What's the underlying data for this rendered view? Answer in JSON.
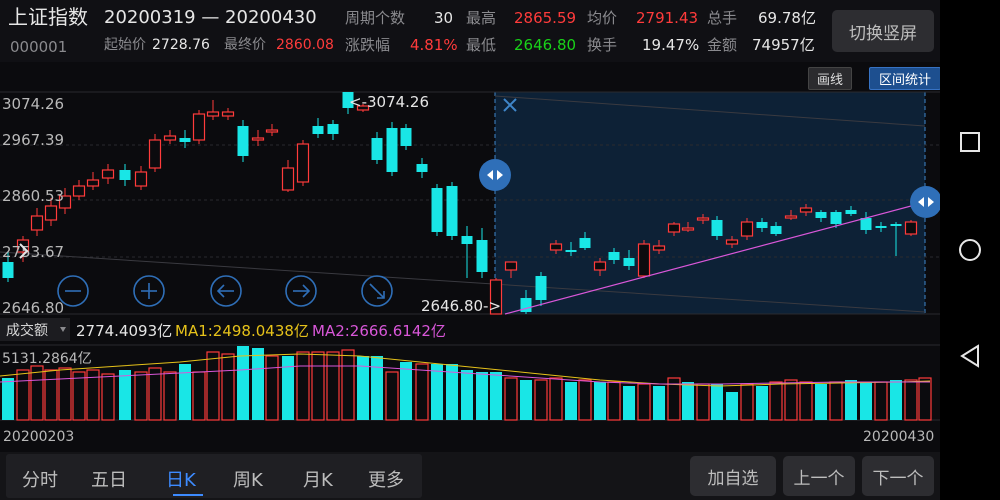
{
  "header": {
    "index_name": "上证指数",
    "index_code": "000001",
    "date_range": "20200319 — 20200430",
    "start_label": "起始价",
    "start_value": "2728.76",
    "end_label": "最终价",
    "end_value": "2860.08",
    "period_label": "周期个数",
    "period_value": "30",
    "change_label": "涨跌幅",
    "change_value": "4.81%",
    "high_label": "最高",
    "high_value": "2865.59",
    "low_label": "最低",
    "low_value": "2646.80",
    "avg_label": "均价",
    "avg_value": "2791.43",
    "turnover_label": "换手",
    "turnover_value": "19.47%",
    "total_hands_label": "总手",
    "total_hands_value": "69.78亿",
    "amount_label": "金额",
    "amount_value": "74957亿",
    "switch_button": "切换竖屏"
  },
  "toolbar": {
    "draw_label": "画线",
    "range_stats_label": "区间统计"
  },
  "price_chart": {
    "y_labels": [
      "3074.26",
      "2967.39",
      "2860.53",
      "2753.67",
      "2646.80"
    ],
    "max_annotation": "<-3074.26",
    "min_annotation": "2646.80->",
    "close_icon": "close-icon",
    "controls": [
      "zoom-out-icon",
      "zoom-in-icon",
      "arrow-left-icon",
      "arrow-right-icon",
      "collapse-icon"
    ],
    "colors": {
      "up": "#ff3b3b",
      "down": "#19e6e6",
      "range_fill": "#0f2a44",
      "trend_line": "#d957d9"
    }
  },
  "volume_chart": {
    "indicator_label": "成交额",
    "value": "2774.4093亿",
    "ma1": "MA1:2498.0438亿",
    "ma2": "MA2:2666.6142亿",
    "max_label": "5131.2864亿",
    "start_date": "20200203",
    "end_date": "20200430",
    "colors": {
      "ma1": "#e6c21a",
      "ma2": "#d957d9"
    }
  },
  "tabs": [
    {
      "label": "分时",
      "active": false
    },
    {
      "label": "五日",
      "active": false
    },
    {
      "label": "日K",
      "active": true
    },
    {
      "label": "周K",
      "active": false
    },
    {
      "label": "月K",
      "active": false
    },
    {
      "label": "更多",
      "active": false
    }
  ],
  "actions": {
    "add_watch": "加自选",
    "prev": "上一个",
    "next": "下一个"
  },
  "system_nav": [
    "square-icon",
    "circle-icon",
    "back-triangle-icon"
  ]
}
